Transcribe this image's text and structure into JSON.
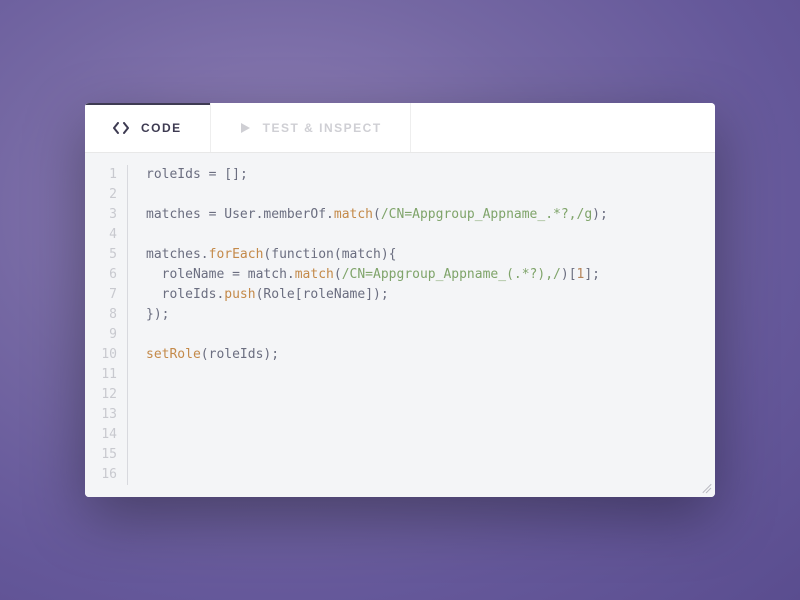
{
  "tabs": {
    "code": "CODE",
    "test": "TEST & INSPECT"
  },
  "editor": {
    "total_lines": 16,
    "lines": [
      {
        "n": 1,
        "tokens": [
          [
            "id",
            "roleIds"
          ],
          [
            "op",
            " = "
          ],
          [
            "br",
            "[]"
          ],
          [
            "op",
            ";"
          ]
        ]
      },
      {
        "n": 2,
        "tokens": []
      },
      {
        "n": 3,
        "tokens": [
          [
            "id",
            "matches"
          ],
          [
            "op",
            " = "
          ],
          [
            "id",
            "User"
          ],
          [
            "op",
            "."
          ],
          [
            "id",
            "memberOf"
          ],
          [
            "op",
            "."
          ],
          [
            "fn",
            "match"
          ],
          [
            "br",
            "("
          ],
          [
            "str",
            "/CN=Appgroup_Appname_.*?,/g"
          ],
          [
            "br",
            ")"
          ],
          [
            "op",
            ";"
          ]
        ]
      },
      {
        "n": 4,
        "tokens": []
      },
      {
        "n": 5,
        "tokens": [
          [
            "id",
            "matches"
          ],
          [
            "op",
            "."
          ],
          [
            "fn",
            "forEach"
          ],
          [
            "br",
            "("
          ],
          [
            "id",
            "function"
          ],
          [
            "br",
            "("
          ],
          [
            "id",
            "match"
          ],
          [
            "br",
            ")"
          ],
          [
            "br",
            "{"
          ]
        ]
      },
      {
        "n": 6,
        "tokens": [
          [
            "id",
            "  roleName"
          ],
          [
            "op",
            " = "
          ],
          [
            "id",
            "match"
          ],
          [
            "op",
            "."
          ],
          [
            "fn",
            "match"
          ],
          [
            "br",
            "("
          ],
          [
            "str",
            "/CN=Appgroup_Appname_(.*?),/"
          ],
          [
            "br",
            ")"
          ],
          [
            "br",
            "["
          ],
          [
            "num",
            "1"
          ],
          [
            "br",
            "]"
          ],
          [
            "op",
            ";"
          ]
        ]
      },
      {
        "n": 7,
        "tokens": [
          [
            "id",
            "  roleIds"
          ],
          [
            "op",
            "."
          ],
          [
            "fn",
            "push"
          ],
          [
            "br",
            "("
          ],
          [
            "id",
            "Role"
          ],
          [
            "br",
            "["
          ],
          [
            "id",
            "roleName"
          ],
          [
            "br",
            "]"
          ],
          [
            "br",
            ")"
          ],
          [
            "op",
            ";"
          ]
        ]
      },
      {
        "n": 8,
        "tokens": [
          [
            "br",
            "}"
          ],
          [
            "br",
            ")"
          ],
          [
            "op",
            ";"
          ]
        ]
      },
      {
        "n": 9,
        "tokens": []
      },
      {
        "n": 10,
        "tokens": [
          [
            "fn",
            "setRole"
          ],
          [
            "br",
            "("
          ],
          [
            "id",
            "roleIds"
          ],
          [
            "br",
            ")"
          ],
          [
            "op",
            ";"
          ]
        ]
      },
      {
        "n": 11,
        "tokens": []
      },
      {
        "n": 12,
        "tokens": []
      },
      {
        "n": 13,
        "tokens": []
      },
      {
        "n": 14,
        "tokens": []
      },
      {
        "n": 15,
        "tokens": []
      },
      {
        "n": 16,
        "tokens": []
      }
    ]
  }
}
